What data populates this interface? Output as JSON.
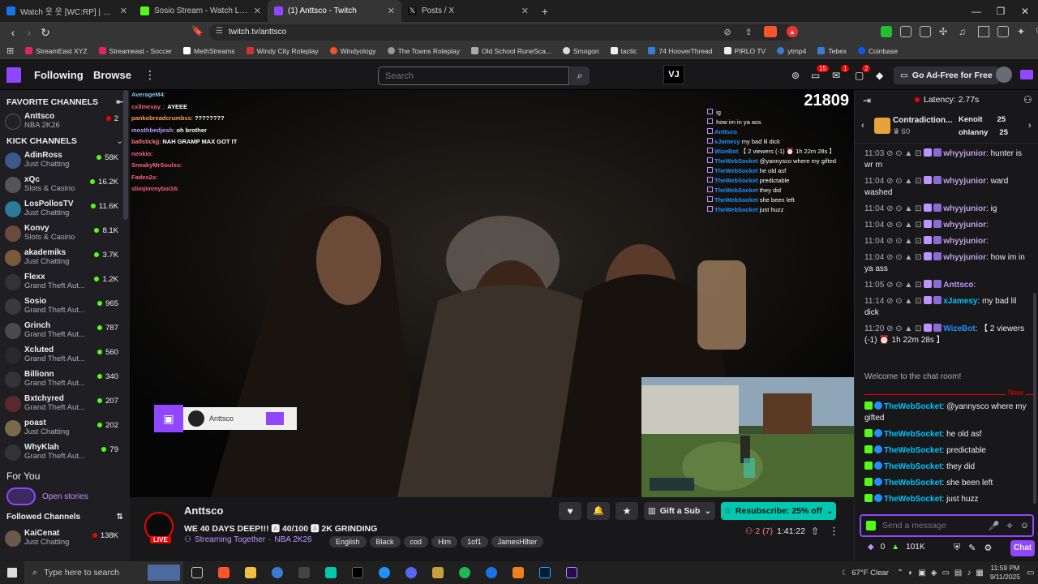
{
  "browser": {
    "tabs": [
      {
        "title": "Watch 웃 웃 [WC:RP] | Streamable",
        "color": "#1a73e8",
        "active": false
      },
      {
        "title": "Sosio Stream - Watch Live on Kick",
        "color": "#53fc18",
        "active": false
      },
      {
        "title": "(1) Anttsco - Twitch",
        "color": "#9146ff",
        "active": true
      },
      {
        "title": "Posts / X",
        "color": "#ffffff",
        "active": false
      }
    ],
    "url": "twitch.tv/anttsco",
    "bookmarks": [
      "StreamEast XYZ",
      "Streameast - Soccer",
      "MethStreams",
      "Windy City Roleplay",
      "Windyology",
      "The Towns Roleplay",
      "Old School RuneSca...",
      "Smogon",
      "tactic",
      "74 HooverThread",
      "PIRLO TV",
      "ytmp4",
      "Tebex",
      "Coinbase"
    ]
  },
  "twitch_nav": {
    "following": "Following",
    "browse": "Browse",
    "search_placeholder": "Search",
    "badges": {
      "inbox": "15",
      "whispers": "1",
      "notifications": "2"
    },
    "ad_free": "Go Ad-Free for Free"
  },
  "sidebar": {
    "favorite_header": "FAVORITE CHANNELS",
    "favorites": [
      {
        "name": "Anttsco",
        "game": "NBA 2K26",
        "viewers": "2"
      }
    ],
    "kick_header": "KICK CHANNELS",
    "kick": [
      {
        "name": "AdinRoss",
        "game": "Just Chatting",
        "viewers": "58K"
      },
      {
        "name": "xQc",
        "game": "Slots & Casino",
        "viewers": "16.2K"
      },
      {
        "name": "LosPollosTV",
        "game": "Just Chatting",
        "viewers": "11.6K"
      },
      {
        "name": "Konvy",
        "game": "Slots & Casino",
        "viewers": "8.1K"
      },
      {
        "name": "akademiks",
        "game": "Just Chatting",
        "viewers": "3.7K"
      },
      {
        "name": "Flexx",
        "game": "Grand Theft Aut...",
        "viewers": "1.2K"
      },
      {
        "name": "Sosio",
        "game": "Grand Theft Aut...",
        "viewers": "965"
      },
      {
        "name": "Grinch",
        "game": "Grand Theft Aut...",
        "viewers": "787"
      },
      {
        "name": "Xcluted",
        "game": "Grand Theft Aut...",
        "viewers": "560"
      },
      {
        "name": "Billionn",
        "game": "Grand Theft Aut...",
        "viewers": "340"
      },
      {
        "name": "Bxtchyred",
        "game": "Grand Theft Aut...",
        "viewers": "207"
      },
      {
        "name": "poast",
        "game": "Just Chatting",
        "viewers": "202"
      },
      {
        "name": "WhyKlah",
        "game": "Grand Theft Aut...",
        "viewers": "79"
      }
    ],
    "for_you": "For You",
    "open_stories": "Open stories",
    "followed_header": "Followed Channels",
    "followed": [
      {
        "name": "KaiCenat",
        "game": "Just Chatting",
        "viewers": "138K"
      }
    ]
  },
  "video": {
    "counter": "21809",
    "overlay_name": "Anttsco",
    "overlay_chat_left": [
      {
        "user": "AverageM4",
        "text": ""
      },
      {
        "user": "cxllmexay_",
        "text": "AYEEE"
      },
      {
        "user": "pankobreadcrumbss",
        "text": "????????"
      },
      {
        "user": "mosthbedjosh",
        "text": "oh brother"
      },
      {
        "user": "ballstickjj",
        "text": "NAH GRAMP MAX GOT IT"
      },
      {
        "user": "neokio",
        "text": ""
      },
      {
        "user": "SneakyMrSoulss",
        "text": ""
      },
      {
        "user": "Fades2x",
        "text": ""
      },
      {
        "user": "slimjimmyboi16",
        "text": ""
      }
    ],
    "overlay_chat_right": [
      {
        "user": "",
        "text": "ig"
      },
      {
        "user": "",
        "text": "how im in ya ass"
      },
      {
        "user": "Anttsco",
        "text": ""
      },
      {
        "user": "xJamesy",
        "text": "my bad lil dick"
      },
      {
        "user": "WizeBot",
        "text": "【 2 viewers (-1) ⏰ 1h 22m 28s 】"
      },
      {
        "user": "TheWebSocket",
        "text": "@yannysco where my gifted"
      },
      {
        "user": "TheWebSocket",
        "text": "he old asf"
      },
      {
        "user": "TheWebSocket",
        "text": "predictable"
      },
      {
        "user": "TheWebSocket",
        "text": "they did"
      },
      {
        "user": "TheWebSocket",
        "text": "she been left"
      },
      {
        "user": "TheWebSocket",
        "text": "just huzz"
      }
    ]
  },
  "stream_info": {
    "channel": "Anttsco",
    "live": "LIVE",
    "title": "WE 40 DAYS DEEP!!! 🅰 40/100 🅰 2K GRINDING",
    "streaming_together": "Streaming Together",
    "category": "NBA 2K26",
    "tags": [
      "English",
      "Black",
      "cod",
      "Him",
      "1of1",
      "JamesH8ter"
    ],
    "viewers": "2 (7)",
    "uptime": "1:41:22",
    "gift_sub": "Gift a Sub",
    "resub": "Resubscribe: 25% off"
  },
  "chat": {
    "latency": "Latency: 2.77s",
    "hype": {
      "name": "Contradiction...",
      "count": "60"
    },
    "leaders": [
      {
        "name": "Kenoit",
        "count": "25"
      },
      {
        "name": "ohlanny",
        "count": "25"
      }
    ],
    "messages": [
      {
        "time": "11:03",
        "user": "whyyjunior",
        "color": "#b9a3e3",
        "text": "hunter is wr rn"
      },
      {
        "time": "11:04",
        "user": "whyyjunior",
        "color": "#b9a3e3",
        "text": "ward washed"
      },
      {
        "time": "11:04",
        "user": "whyyjunior",
        "color": "#b9a3e3",
        "text": "ig"
      },
      {
        "time": "11:04",
        "user": "whyyjunior",
        "color": "#b9a3e3",
        "text": ""
      },
      {
        "time": "11:04",
        "user": "whyyjunior",
        "color": "#b9a3e3",
        "text": ""
      },
      {
        "time": "11:04",
        "user": "whyyjunior",
        "color": "#b9a3e3",
        "text": "how im in ya ass"
      },
      {
        "time": "11:05",
        "user": "Anttsco",
        "color": "#bf94ff",
        "text": ""
      },
      {
        "time": "11:14",
        "user": "xJamesy",
        "color": "#00c3ff",
        "text": "my bad lil dick"
      },
      {
        "time": "11:20",
        "user": "WizeBot",
        "color": "#1e90ff",
        "text": "【 2 viewers (-1) ⏰ 1h 22m 28s 】"
      }
    ],
    "welcome": "Welcome to the chat room!",
    "new_label": "New",
    "messages2": [
      {
        "user": "TheWebSocket",
        "text": "@yannysco where my gifted"
      },
      {
        "user": "TheWebSocket",
        "text": "he old asf"
      },
      {
        "user": "TheWebSocket",
        "text": "predictable"
      },
      {
        "user": "TheWebSocket",
        "text": "they did"
      },
      {
        "user": "TheWebSocket",
        "text": "she been left"
      },
      {
        "user": "TheWebSocket",
        "text": "just huzz"
      }
    ],
    "placeholder": "Send a message",
    "points": "0",
    "kick_points": "101K",
    "chat_button": "Chat"
  },
  "taskbar": {
    "search": "Type here to search",
    "weather": "67°F  Clear",
    "time": "11:59 PM",
    "date": "9/11/2025"
  }
}
